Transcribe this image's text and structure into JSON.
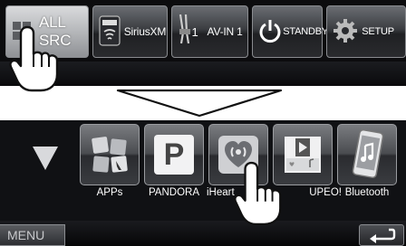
{
  "top_bar": {
    "all_src": [
      "ALL",
      "SRC"
    ],
    "siriusxm_label": "SiriusXM",
    "siriusxm_logo_text": "SiriusXM",
    "av_in_number": "1",
    "av_in_label": "AV-IN 1",
    "standby_label": "STANDBY",
    "setup_label": "SETUP"
  },
  "source_tiles": [
    {
      "label": "APPs",
      "icon": "apps-icon"
    },
    {
      "label": "PANDORA",
      "icon": "pandora-icon"
    },
    {
      "label": "iHeart",
      "icon": "iheart-icon"
    },
    {
      "label": "UPEO!",
      "icon": "slacker-icon"
    },
    {
      "label": "Bluetooth",
      "icon": "phone-icon"
    }
  ],
  "pandora_letter": "P",
  "bottom_bar": {
    "menu_label": "MENU",
    "back_icon": "return-arrow-icon"
  },
  "colors": {
    "panel_bg": "#101114",
    "button_border": "#8a8c90",
    "label_text": "#ffffff"
  }
}
